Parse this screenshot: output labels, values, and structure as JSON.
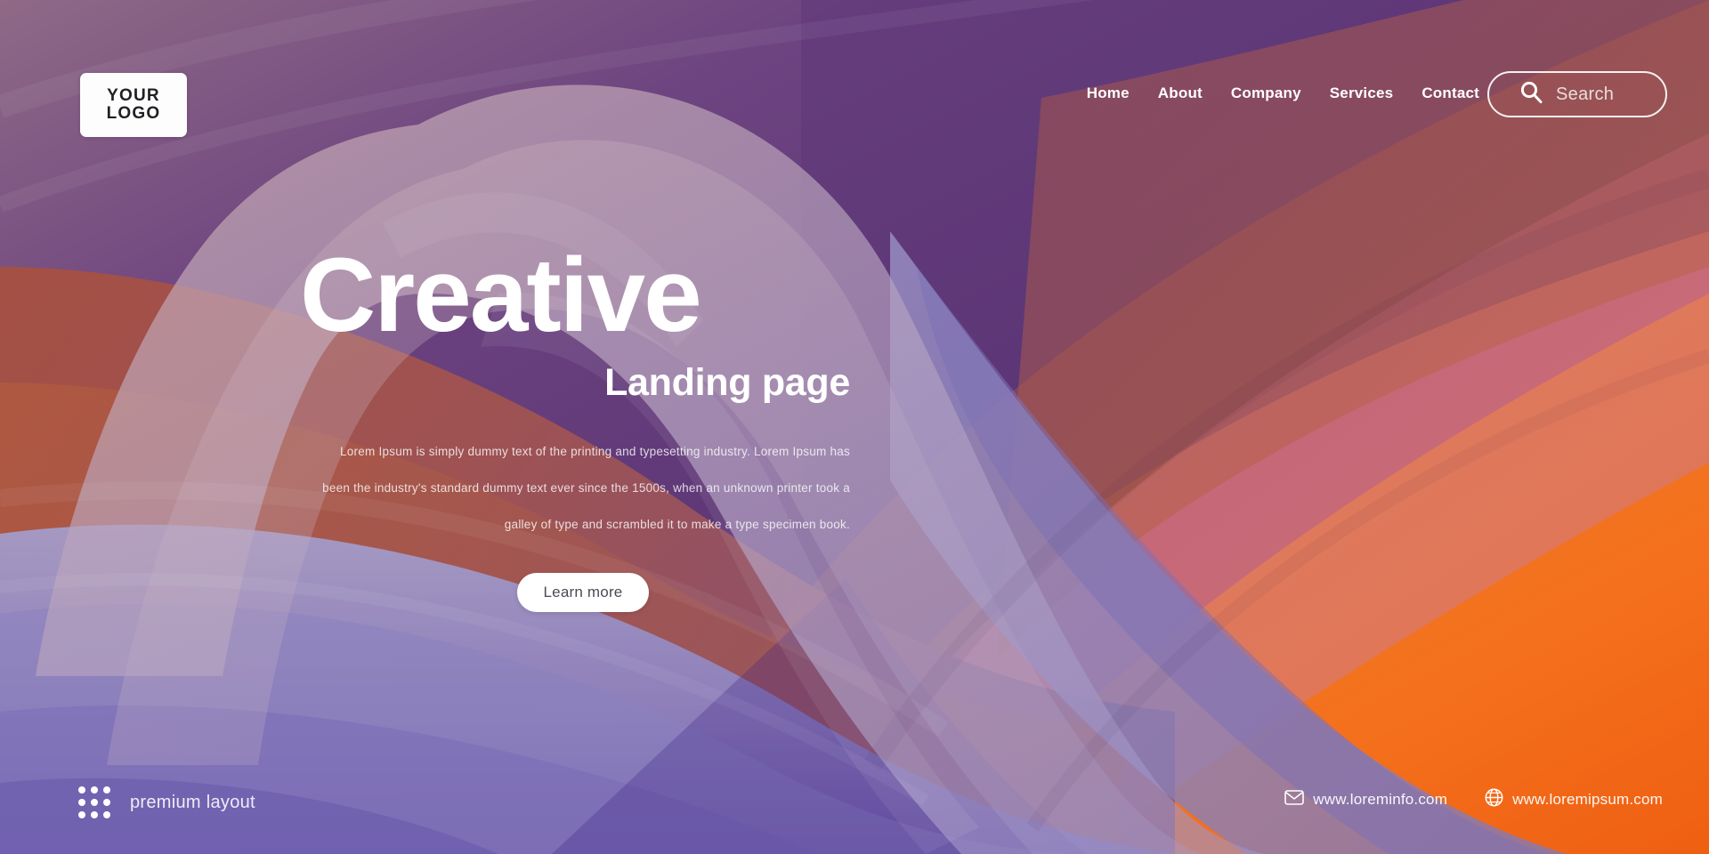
{
  "brand": {
    "logo_line1": "YOUR",
    "logo_line2": "LOGO"
  },
  "nav": {
    "items": [
      {
        "label": "Home"
      },
      {
        "label": "About"
      },
      {
        "label": "Company"
      },
      {
        "label": "Services"
      },
      {
        "label": "Contact"
      }
    ]
  },
  "search": {
    "placeholder": "Search",
    "value": "",
    "icon": "search-icon"
  },
  "hero": {
    "title": "Creative",
    "subtitle": "Landing page",
    "paragraph_lines": [
      "Lorem Ipsum is simply dummy text of the printing and typesetting industry. Lorem Ipsum has",
      "been the industry's standard dummy text ever since the 1500s, when an unknown printer took a",
      "galley of type and scrambled it to make a type specimen book."
    ],
    "cta_label": "Learn more"
  },
  "footer": {
    "premium_label": "premium layout",
    "grid_icon": "dot-grid-icon",
    "contacts": [
      {
        "icon": "envelope-icon",
        "label": "www.loreminfo.com"
      },
      {
        "icon": "globe-icon",
        "label": "www.loremipsum.com"
      }
    ]
  },
  "colors": {
    "purple_dark": "#54306f",
    "purple_mid": "#6e4a86",
    "mauve": "#9b7d9b",
    "lavender": "#8f87bd",
    "indigo": "#4b2e8f",
    "maroon": "#9b4f54",
    "pink": "#c4667f",
    "salmon": "#dd7a63",
    "orange": "#f4701f",
    "white": "#ffffff"
  }
}
